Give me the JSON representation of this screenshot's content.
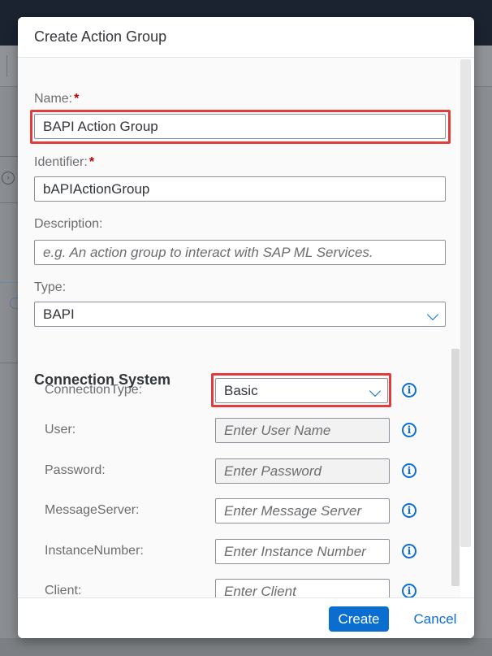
{
  "dialog": {
    "title": "Create Action Group",
    "name": {
      "label": "Name:",
      "required_mark": "*",
      "value": "BAPI Action Group"
    },
    "identifier": {
      "label": "Identifier:",
      "required_mark": "*",
      "value": "bAPIActionGroup"
    },
    "description": {
      "label": "Description:",
      "placeholder": "e.g. An action group to interact with SAP ML Services."
    },
    "type": {
      "label": "Type:",
      "value": "BAPI"
    },
    "connection_system": {
      "title": "Connection System",
      "fields": [
        {
          "label": "ConnectionType:",
          "value": "Basic"
        },
        {
          "label": "User:",
          "placeholder": "Enter User Name"
        },
        {
          "label": "Password:",
          "placeholder": "Enter Password"
        },
        {
          "label": "MessageServer:",
          "placeholder": "Enter Message Server"
        },
        {
          "label": "InstanceNumber:",
          "placeholder": "Enter Instance Number"
        },
        {
          "label": "Client:",
          "placeholder": "Enter Client"
        }
      ]
    },
    "footer": {
      "create_label": "Create",
      "cancel_label": "Cancel"
    }
  },
  "icons": {
    "info": "info-icon",
    "dropdown": "chevron-down-icon"
  },
  "colors": {
    "accent": "#0a6ed1",
    "highlight": "#e23c3c",
    "required": "#bb0000"
  }
}
